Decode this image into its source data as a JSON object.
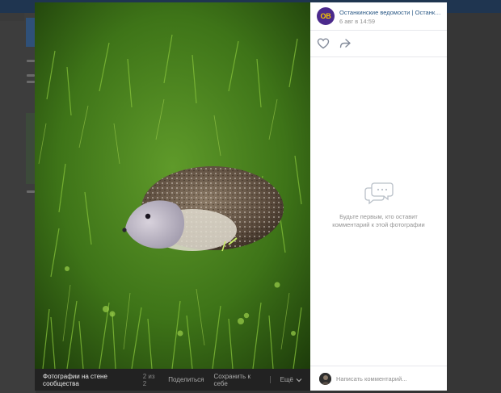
{
  "viewer": {
    "album_label": "Фотографии на стене сообщества",
    "counter": "2 из 2",
    "share_label": "Поделиться",
    "save_label": "Сохранить к себе",
    "more_label": "Ещё"
  },
  "post": {
    "avatar_text": "OB",
    "author": "Останкинские ведомости | Останкино",
    "date": "6 авг в 14:59"
  },
  "comments": {
    "empty_text": "Будьте первым, кто оставит комментарий к этой фотографии",
    "input_placeholder": "Написать комментарий..."
  },
  "colors": {
    "avatar_bg": "#4b2a8c",
    "avatar_text": "#f6c400",
    "link": "#2a5885"
  }
}
